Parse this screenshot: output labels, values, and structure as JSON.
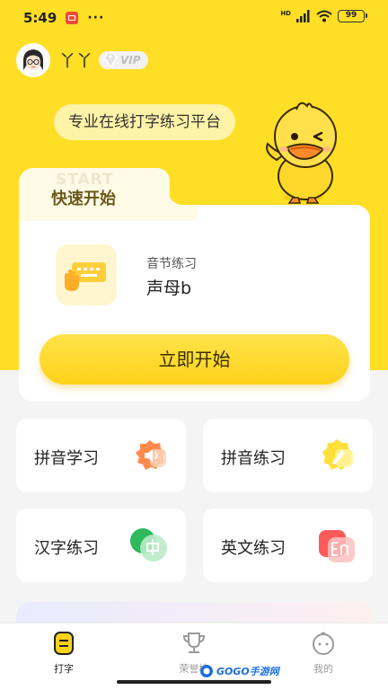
{
  "status_bar": {
    "time": "5:49",
    "more": "···",
    "network_badge": "HD",
    "battery": "99"
  },
  "user": {
    "name": "丫丫",
    "vip_label": "VIP"
  },
  "banner": {
    "slogan": "专业在线打字练习平台"
  },
  "quick_start": {
    "ghost_text": "START",
    "title": "快速开始",
    "lesson_category": "音节练习",
    "lesson_name": "声母b",
    "start_button": "立即开始"
  },
  "features": [
    {
      "label": "拼音学习",
      "icon": "speaker-icon"
    },
    {
      "label": "拼音练习",
      "icon": "pencil-icon"
    },
    {
      "label": "汉字练习",
      "icon": "zhong-character-icon"
    },
    {
      "label": "英文练习",
      "icon": "en-letters-icon"
    }
  ],
  "tabbar": {
    "items": [
      {
        "label": "打字",
        "icon": "keyboard-icon",
        "active": true
      },
      {
        "label": "荣誉榜",
        "icon": "trophy-icon",
        "active": false
      },
      {
        "label": "我的",
        "icon": "profile-face-icon",
        "active": false
      }
    ]
  },
  "watermark": {
    "text": "GOGO手游网"
  },
  "colors": {
    "brand_yellow": "#ffde26",
    "button_yellow": "#ffd21a",
    "page_bg": "#f4f4f4",
    "feature_orange": "#ff8a4c",
    "feature_yellow": "#ffe03a",
    "feature_green": "#3bc46a",
    "feature_red": "#ff5a5a"
  }
}
